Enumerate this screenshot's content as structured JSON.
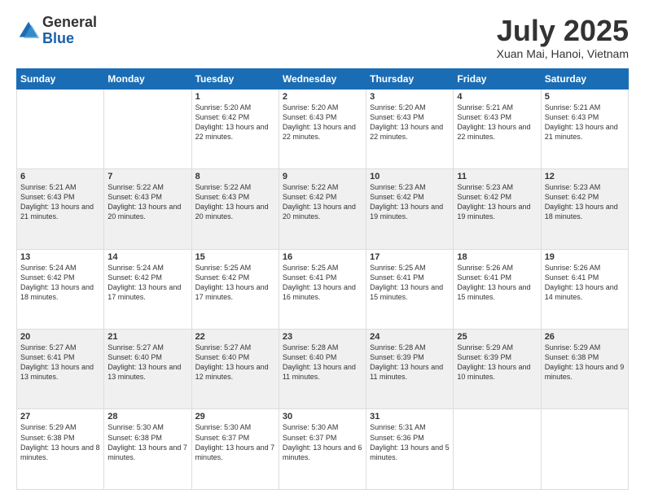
{
  "logo": {
    "general": "General",
    "blue": "Blue"
  },
  "header": {
    "title": "July 2025",
    "subtitle": "Xuan Mai, Hanoi, Vietnam"
  },
  "weekdays": [
    "Sunday",
    "Monday",
    "Tuesday",
    "Wednesday",
    "Thursday",
    "Friday",
    "Saturday"
  ],
  "weeks": [
    [
      {
        "day": "",
        "info": ""
      },
      {
        "day": "",
        "info": ""
      },
      {
        "day": "1",
        "info": "Sunrise: 5:20 AM\nSunset: 6:42 PM\nDaylight: 13 hours and 22 minutes."
      },
      {
        "day": "2",
        "info": "Sunrise: 5:20 AM\nSunset: 6:43 PM\nDaylight: 13 hours and 22 minutes."
      },
      {
        "day": "3",
        "info": "Sunrise: 5:20 AM\nSunset: 6:43 PM\nDaylight: 13 hours and 22 minutes."
      },
      {
        "day": "4",
        "info": "Sunrise: 5:21 AM\nSunset: 6:43 PM\nDaylight: 13 hours and 22 minutes."
      },
      {
        "day": "5",
        "info": "Sunrise: 5:21 AM\nSunset: 6:43 PM\nDaylight: 13 hours and 21 minutes."
      }
    ],
    [
      {
        "day": "6",
        "info": "Sunrise: 5:21 AM\nSunset: 6:43 PM\nDaylight: 13 hours and 21 minutes."
      },
      {
        "day": "7",
        "info": "Sunrise: 5:22 AM\nSunset: 6:43 PM\nDaylight: 13 hours and 20 minutes."
      },
      {
        "day": "8",
        "info": "Sunrise: 5:22 AM\nSunset: 6:43 PM\nDaylight: 13 hours and 20 minutes."
      },
      {
        "day": "9",
        "info": "Sunrise: 5:22 AM\nSunset: 6:42 PM\nDaylight: 13 hours and 20 minutes."
      },
      {
        "day": "10",
        "info": "Sunrise: 5:23 AM\nSunset: 6:42 PM\nDaylight: 13 hours and 19 minutes."
      },
      {
        "day": "11",
        "info": "Sunrise: 5:23 AM\nSunset: 6:42 PM\nDaylight: 13 hours and 19 minutes."
      },
      {
        "day": "12",
        "info": "Sunrise: 5:23 AM\nSunset: 6:42 PM\nDaylight: 13 hours and 18 minutes."
      }
    ],
    [
      {
        "day": "13",
        "info": "Sunrise: 5:24 AM\nSunset: 6:42 PM\nDaylight: 13 hours and 18 minutes."
      },
      {
        "day": "14",
        "info": "Sunrise: 5:24 AM\nSunset: 6:42 PM\nDaylight: 13 hours and 17 minutes."
      },
      {
        "day": "15",
        "info": "Sunrise: 5:25 AM\nSunset: 6:42 PM\nDaylight: 13 hours and 17 minutes."
      },
      {
        "day": "16",
        "info": "Sunrise: 5:25 AM\nSunset: 6:41 PM\nDaylight: 13 hours and 16 minutes."
      },
      {
        "day": "17",
        "info": "Sunrise: 5:25 AM\nSunset: 6:41 PM\nDaylight: 13 hours and 15 minutes."
      },
      {
        "day": "18",
        "info": "Sunrise: 5:26 AM\nSunset: 6:41 PM\nDaylight: 13 hours and 15 minutes."
      },
      {
        "day": "19",
        "info": "Sunrise: 5:26 AM\nSunset: 6:41 PM\nDaylight: 13 hours and 14 minutes."
      }
    ],
    [
      {
        "day": "20",
        "info": "Sunrise: 5:27 AM\nSunset: 6:41 PM\nDaylight: 13 hours and 13 minutes."
      },
      {
        "day": "21",
        "info": "Sunrise: 5:27 AM\nSunset: 6:40 PM\nDaylight: 13 hours and 13 minutes."
      },
      {
        "day": "22",
        "info": "Sunrise: 5:27 AM\nSunset: 6:40 PM\nDaylight: 13 hours and 12 minutes."
      },
      {
        "day": "23",
        "info": "Sunrise: 5:28 AM\nSunset: 6:40 PM\nDaylight: 13 hours and 11 minutes."
      },
      {
        "day": "24",
        "info": "Sunrise: 5:28 AM\nSunset: 6:39 PM\nDaylight: 13 hours and 11 minutes."
      },
      {
        "day": "25",
        "info": "Sunrise: 5:29 AM\nSunset: 6:39 PM\nDaylight: 13 hours and 10 minutes."
      },
      {
        "day": "26",
        "info": "Sunrise: 5:29 AM\nSunset: 6:38 PM\nDaylight: 13 hours and 9 minutes."
      }
    ],
    [
      {
        "day": "27",
        "info": "Sunrise: 5:29 AM\nSunset: 6:38 PM\nDaylight: 13 hours and 8 minutes."
      },
      {
        "day": "28",
        "info": "Sunrise: 5:30 AM\nSunset: 6:38 PM\nDaylight: 13 hours and 7 minutes."
      },
      {
        "day": "29",
        "info": "Sunrise: 5:30 AM\nSunset: 6:37 PM\nDaylight: 13 hours and 7 minutes."
      },
      {
        "day": "30",
        "info": "Sunrise: 5:30 AM\nSunset: 6:37 PM\nDaylight: 13 hours and 6 minutes."
      },
      {
        "day": "31",
        "info": "Sunrise: 5:31 AM\nSunset: 6:36 PM\nDaylight: 13 hours and 5 minutes."
      },
      {
        "day": "",
        "info": ""
      },
      {
        "day": "",
        "info": ""
      }
    ]
  ]
}
